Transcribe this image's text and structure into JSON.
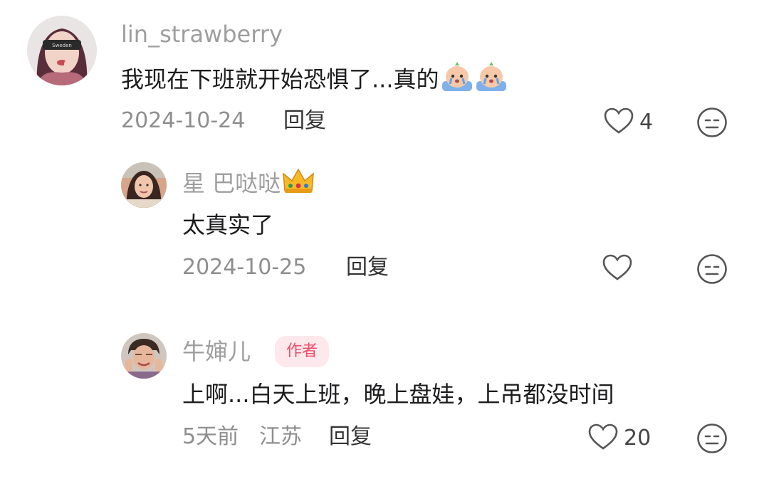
{
  "comments": [
    {
      "username": "lin_strawberry",
      "text": "我现在下班就开始恐惧了...真的",
      "date": "2024-10-24",
      "reply_label": "回复",
      "likes": "4",
      "inline_emojis": [
        "crying-emoji",
        "crying-emoji"
      ]
    }
  ],
  "replies": [
    {
      "username": "星 巴哒哒",
      "username_emoji": "crown-icon",
      "text": "太真实了",
      "date": "2024-10-25",
      "reply_label": "回复",
      "likes": ""
    },
    {
      "username": "牛婶儿",
      "badge": "作者",
      "text": "上啊...白天上班，晚上盘娃，上吊都没时间",
      "date": "5天前",
      "location": "江苏",
      "reply_label": "回复",
      "likes": "20"
    }
  ],
  "colors": {
    "username": "#9e9e9e",
    "text": "#1c1c1e",
    "meta": "#8e8e8e",
    "badge_bg": "#fde8ec",
    "badge_text": "#ee4d6a"
  }
}
